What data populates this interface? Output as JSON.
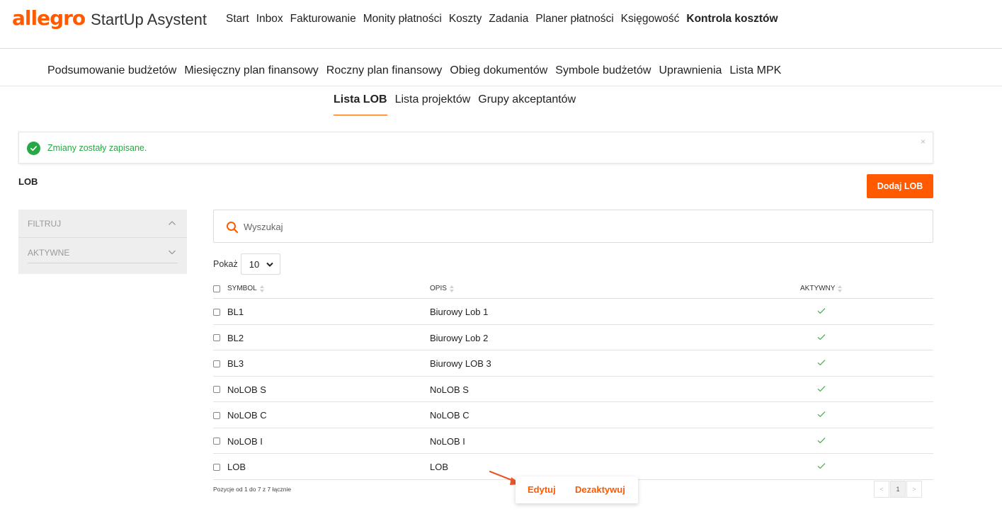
{
  "header": {
    "logo": "allegro",
    "app_name": "StartUp Asystent",
    "nav": [
      "Start",
      "Inbox",
      "Fakturowanie",
      "Monity płatności",
      "Koszty",
      "Zadania",
      "Planer płatności",
      "Księgowość",
      "Kontrola kosztów"
    ],
    "active_nav": "Kontrola kosztów"
  },
  "subnav": [
    "Podsumowanie budżetów",
    "Miesięczny plan finansowy",
    "Roczny plan finansowy",
    "Obieg dokumentów",
    "Symbole budżetów",
    "Uprawnienia",
    "Lista MPK"
  ],
  "tabs": [
    "Lista LOB",
    "Lista projektów",
    "Grupy akceptantów"
  ],
  "active_tab": "Lista LOB",
  "alert": {
    "text": "Zmiany zostały zapisane.",
    "close": "×",
    "color": "#28a745"
  },
  "section": {
    "title": "LOB",
    "add_button": "Dodaj LOB"
  },
  "filter": {
    "title": "FILTRUJ",
    "aktywne": "AKTYWNE"
  },
  "search": {
    "placeholder": "Wyszukaj"
  },
  "show": {
    "label": "Pokaż",
    "value": "10"
  },
  "table": {
    "columns": [
      "SYMBOL",
      "OPIS",
      "AKTYWNY"
    ],
    "rows": [
      {
        "symbol": "BL1",
        "opis": "Biurowy Lob 1",
        "active": true
      },
      {
        "symbol": "BL2",
        "opis": "Biurowy Lob 2",
        "active": true
      },
      {
        "symbol": "BL3",
        "opis": "Biurowy LOB 3",
        "active": true
      },
      {
        "symbol": "NoLOB S",
        "opis": "NoLOB S",
        "active": true
      },
      {
        "symbol": "NoLOB C",
        "opis": "NoLOB C",
        "active": true
      },
      {
        "symbol": "NoLOB I",
        "opis": "NoLOB I",
        "active": true
      },
      {
        "symbol": "LOB",
        "opis": "LOB",
        "active": true
      }
    ]
  },
  "footer": {
    "info": "Pozycje od 1 do 7 z 7 łącznie",
    "page": "1",
    "prev": "<",
    "next": ">"
  },
  "row_actions": {
    "edit": "Edytuj",
    "deactivate": "Dezaktywuj"
  },
  "colors": {
    "accent": "#ff5a00",
    "success": "#28a745"
  }
}
